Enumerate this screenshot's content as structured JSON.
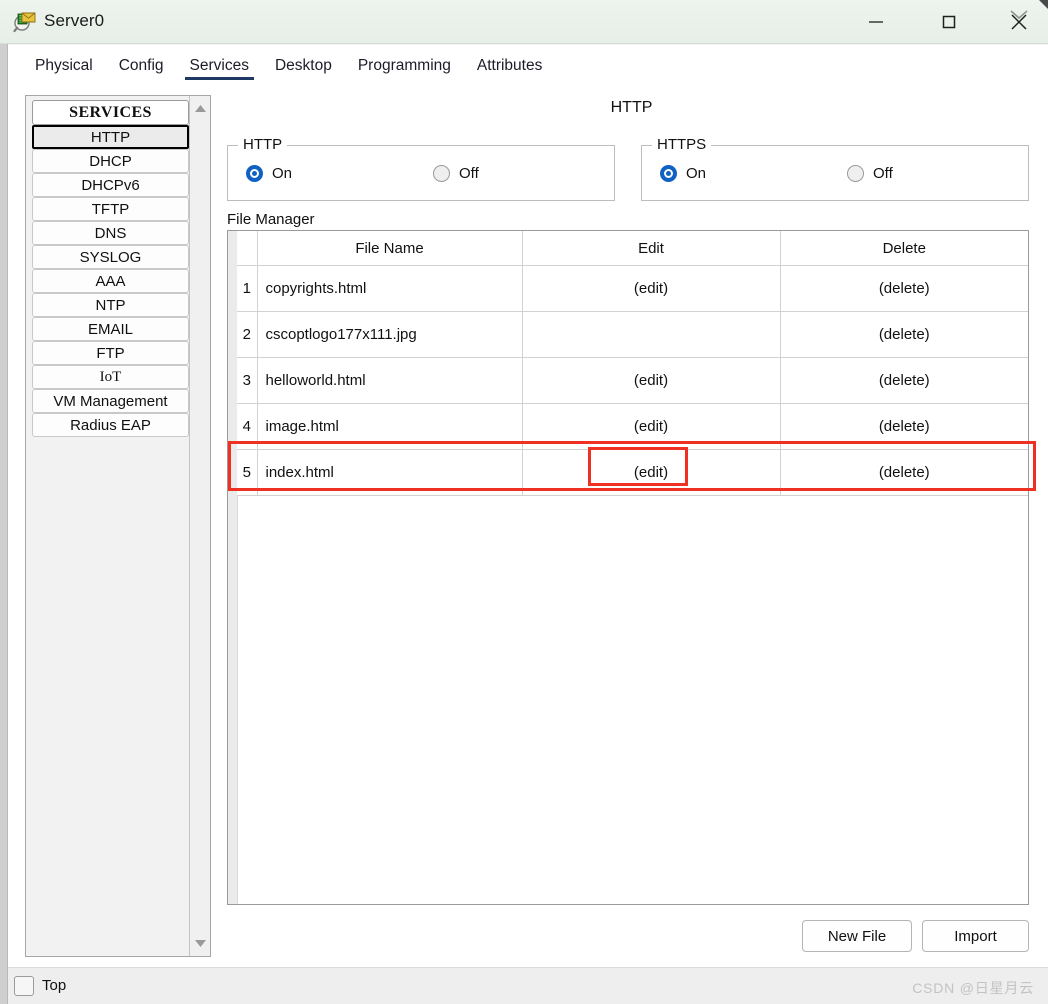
{
  "window": {
    "title": "Server0",
    "icon": "server-mail-icon",
    "controls": {
      "minimize": "minimize-icon",
      "maximize": "maximize-icon",
      "close": "close-icon"
    }
  },
  "tabs": [
    {
      "label": "Physical",
      "active": false
    },
    {
      "label": "Config",
      "active": false
    },
    {
      "label": "Services",
      "active": true
    },
    {
      "label": "Desktop",
      "active": false
    },
    {
      "label": "Programming",
      "active": false
    },
    {
      "label": "Attributes",
      "active": false
    }
  ],
  "sidebar": {
    "header": "SERVICES",
    "items": [
      {
        "label": "HTTP",
        "selected": true
      },
      {
        "label": "DHCP",
        "selected": false
      },
      {
        "label": "DHCPv6",
        "selected": false
      },
      {
        "label": "TFTP",
        "selected": false
      },
      {
        "label": "DNS",
        "selected": false
      },
      {
        "label": "SYSLOG",
        "selected": false
      },
      {
        "label": "AAA",
        "selected": false
      },
      {
        "label": "NTP",
        "selected": false
      },
      {
        "label": "EMAIL",
        "selected": false
      },
      {
        "label": "FTP",
        "selected": false
      },
      {
        "label": "IoT",
        "selected": false
      },
      {
        "label": "VM Management",
        "selected": false
      },
      {
        "label": "Radius EAP",
        "selected": false
      }
    ],
    "scroll_up_icon": "scroll-up-arrow-icon",
    "scroll_down_icon": "scroll-down-arrow-icon"
  },
  "content": {
    "title": "HTTP",
    "http_group": {
      "legend": "HTTP",
      "on_label": "On",
      "off_label": "Off",
      "selected": "On"
    },
    "https_group": {
      "legend": "HTTPS",
      "on_label": "On",
      "off_label": "Off",
      "selected": "On"
    },
    "file_manager": {
      "label": "File Manager",
      "columns": [
        "",
        "File Name",
        "Edit",
        "Delete"
      ],
      "rows": [
        {
          "num": "1",
          "name": "copyrights.html",
          "edit": "(edit)",
          "delete": "(delete)"
        },
        {
          "num": "2",
          "name": "cscoptlogo177x111.jpg",
          "edit": "",
          "delete": "(delete)"
        },
        {
          "num": "3",
          "name": "helloworld.html",
          "edit": "(edit)",
          "delete": "(delete)"
        },
        {
          "num": "4",
          "name": "image.html",
          "edit": "(edit)",
          "delete": "(delete)"
        },
        {
          "num": "5",
          "name": "index.html",
          "edit": "(edit)",
          "delete": "(delete)"
        }
      ]
    },
    "buttons": {
      "new_file": "New File",
      "import": "Import"
    }
  },
  "statusbar": {
    "top_checkbox_label": "Top",
    "top_checked": false,
    "watermark": "CSDN @日星月云"
  },
  "colors": {
    "accent_blue": "#0f62c4",
    "tab_underline": "#1f3864",
    "annotation_red": "#ef3124",
    "titlebar": "#e9f1ea"
  }
}
